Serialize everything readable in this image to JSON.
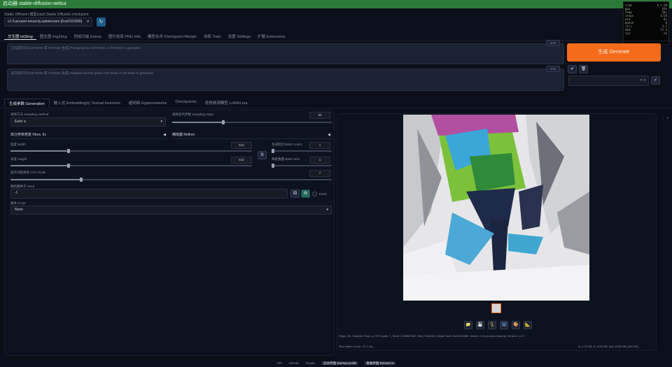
{
  "window": {
    "title": "启动器 stable-diffusion-webui",
    "controls": [
      "↓",
      "□",
      "✕"
    ]
  },
  "overlay_rows": [
    [
      "vram",
      "4.1 GB"
    ],
    [
      "gpu",
      "63%"
    ],
    [
      "temp",
      "58c"
    ],
    [
      "steps",
      "1/20"
    ],
    [
      "eta",
      "0s"
    ],
    [
      "queue",
      "0"
    ],
    [
      "it/s",
      "3.1"
    ],
    [
      "mem",
      "11.4"
    ],
    [
      "sys",
      "ok"
    ]
  ],
  "checkpoint": {
    "label": "Stable Diffusion 模型(ckpt) Stable Diffusion checkpoint",
    "value": "v1-5-pruned-emaonly.safetensors [6ce0161689]",
    "refresh_icon": "refresh-icon"
  },
  "tabs": [
    {
      "label": "文生图 txt2img",
      "active": true
    },
    {
      "label": "图生图 img2img",
      "active": false
    },
    {
      "label": "附加功能 Extras",
      "active": false
    },
    {
      "label": "图片信息 PNG Info",
      "active": false
    },
    {
      "label": "模型合并 Checkpoint Merger",
      "active": false
    },
    {
      "label": "训练 Train",
      "active": false
    },
    {
      "label": "设置 Settings",
      "active": false
    },
    {
      "label": "扩展 Extensions",
      "active": false
    }
  ],
  "prompt": {
    "placeholder": "正向提示词 (Ctrl+Enter 或 Alt+Enter 生成) Prompt (press Ctrl+Enter or Alt+Enter to generate)",
    "tokens": "0/75"
  },
  "neg_prompt": {
    "placeholder": "反向提示词 (Ctrl+Enter 或 Alt+Enter 生成) Negative prompt (press Ctrl+Enter or Alt+Enter to generate)",
    "tokens": "0/75"
  },
  "generate_label": "生成 Generate",
  "side_buttons": {
    "apply": "✔",
    "clear": "🗑",
    "save_style": "✓"
  },
  "style_select_arrows": "✕ ▾",
  "subtabs": [
    {
      "label": "生成参数 Generation",
      "active": true
    },
    {
      "label": "嵌入式 Embedding(s) Textual Inversion",
      "active": false
    },
    {
      "label": "超网络 Hypernetworks",
      "active": false
    },
    {
      "label": "Checkpoints",
      "active": false
    },
    {
      "label": "低秩微调模型 LoRA/Lora",
      "active": false
    }
  ],
  "params": {
    "sampling_method_label": "采样方法 Sampling method",
    "sampling_method_value": "Euler a",
    "sampling_steps_label": "采样迭代步数 Sampling steps",
    "sampling_steps_value": "50",
    "sampling_steps_level": 0.32,
    "hires_label": "高分辨率修复 Hires. fix",
    "refiner_label": "精炼器 Refiner",
    "width_label": "宽度 Width",
    "width_value": "512",
    "width_level": 0.24,
    "height_label": "高度 Height",
    "height_value": "512",
    "height_level": 0.24,
    "batch_count_label": "生成批次 Batch count",
    "batch_count_value": "1",
    "batch_count_level": 0.0,
    "batch_size_label": "每批数量 Batch size",
    "batch_size_value": "1",
    "batch_size_level": 0.0,
    "cfg_label": "提示词相关性 CFG Scale",
    "cfg_value": "7",
    "cfg_level": 0.22,
    "seed_label": "随机数种子 Seed",
    "seed_value": "-1",
    "extra_label": "Extra",
    "script_label": "脚本 Script",
    "script_value": "None",
    "swap_icon": "⇅"
  },
  "output": {
    "info": "Steps: 50, Sampler: Euler a, CFG scale: 7, Seed: 1234567890, Size: 512x512, Model hash: 6ce0161689, Model: v1-5-pruned-emaonly, Version: 1.6.0",
    "time": "Time taken: 5 min. 27.2 sec.",
    "stats": "A: 4.79 GB, R: 6.54 GB, Sys: 8.0/8 GB (100.0%)",
    "corner_buttons": [
      "↓",
      "✕"
    ],
    "actions": [
      {
        "icon": "folder-icon",
        "glyph": "📁"
      },
      {
        "icon": "save-icon",
        "glyph": "💾"
      },
      {
        "icon": "zip-icon",
        "glyph": "🗜"
      },
      {
        "icon": "img2img-icon",
        "glyph": "🖼"
      },
      {
        "icon": "inpaint-icon",
        "glyph": "🎨"
      },
      {
        "icon": "extras-icon",
        "glyph": "📐"
      }
    ]
  },
  "footer": [
    {
      "label": "API",
      "hl": false
    },
    {
      "label": "GitHub",
      "hl": false
    },
    {
      "label": "Gradio",
      "hl": false
    },
    {
      "label": "启动界面 Startup profile",
      "hl": true
    },
    {
      "label": "重载界面 Reload UI",
      "hl": true
    }
  ],
  "colors": {
    "accent": "#f46b1b",
    "bg": "#0b0f19",
    "titlebar": "#2c7a3a"
  }
}
